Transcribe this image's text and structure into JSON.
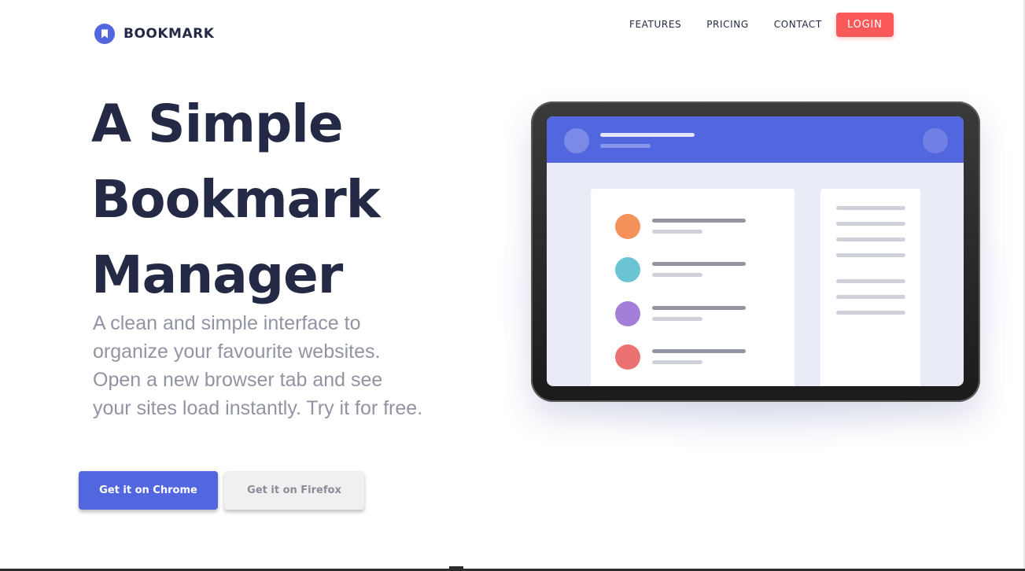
{
  "brand": {
    "name": "BOOKMARK",
    "accent_color": "#5267df",
    "icon": "bookmark-icon"
  },
  "nav": {
    "links": [
      "FEATURES",
      "PRICING",
      "CONTACT"
    ],
    "login_label": "LOGIN",
    "login_color": "#fa5959"
  },
  "hero": {
    "title_lines": [
      "A Simple",
      "Bookmark",
      "Manager"
    ],
    "description": "A clean and simple interface to organize your favourite websites. Open a new browser tab and see your sites load instantly. Try it for free.",
    "cta_primary": "Get it on Chrome",
    "cta_secondary": "Get it on Firefox"
  },
  "illustration": {
    "list_dot_colors": [
      "#f5915a",
      "#6bc4d4",
      "#a47fd9",
      "#ec7272"
    ]
  }
}
